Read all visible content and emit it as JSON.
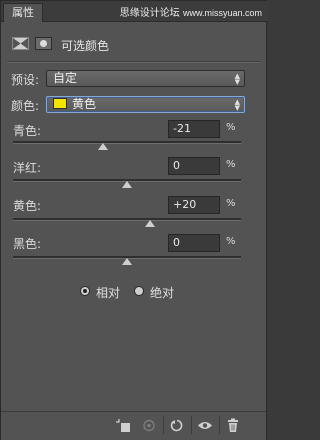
{
  "tabs": [
    "属性"
  ],
  "watermark": {
    "cn": "思缘设计论坛",
    "site": "www.missyuan.com"
  },
  "header": {
    "title": "可选颜色"
  },
  "preset": {
    "label": "预设:",
    "value": "自定"
  },
  "color": {
    "label": "颜色:",
    "value": "黄色",
    "swatch": "#f5e300"
  },
  "sliders": [
    {
      "label": "青色:",
      "value": "-21",
      "unit": "%",
      "percent": -21
    },
    {
      "label": "洋红:",
      "value": "0",
      "unit": "%",
      "percent": 0
    },
    {
      "label": "黄色:",
      "value": "+20",
      "unit": "%",
      "percent": 20
    },
    {
      "label": "黑色:",
      "value": "0",
      "unit": "%",
      "percent": 0
    }
  ],
  "method": {
    "relative": "相对",
    "absolute": "绝对",
    "selected": "relative"
  },
  "icons": [
    "clip-to-layer-icon",
    "view-previous-icon",
    "reset-icon",
    "visibility-icon",
    "trash-icon"
  ]
}
